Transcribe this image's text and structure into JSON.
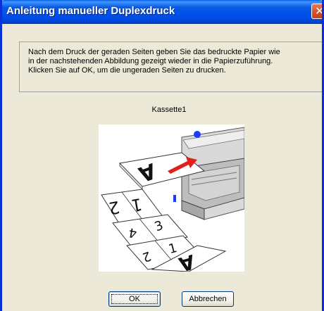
{
  "window": {
    "title": "Anleitung manueller Duplexdruck",
    "close_glyph": "✕"
  },
  "message": {
    "lines": [
      "Nach dem Druck der geraden Seiten geben Sie das bedruckte Papier wie",
      "in der nachstehenden Abbildung gezeigt wieder in die Papierzuführung.",
      "Klicken Sie auf OK, um die ungeraden Seiten zu drucken."
    ]
  },
  "tray": {
    "label": "Kassette1"
  },
  "illustration": {
    "page_glyphs": [
      "A",
      "2",
      "1",
      "4",
      "3",
      "2",
      "1",
      "A"
    ],
    "accent_color": "#e0201c",
    "printer_led_color": "#1a3cff"
  },
  "buttons": {
    "ok_label": "OK",
    "cancel_label": "Abbrechen"
  }
}
